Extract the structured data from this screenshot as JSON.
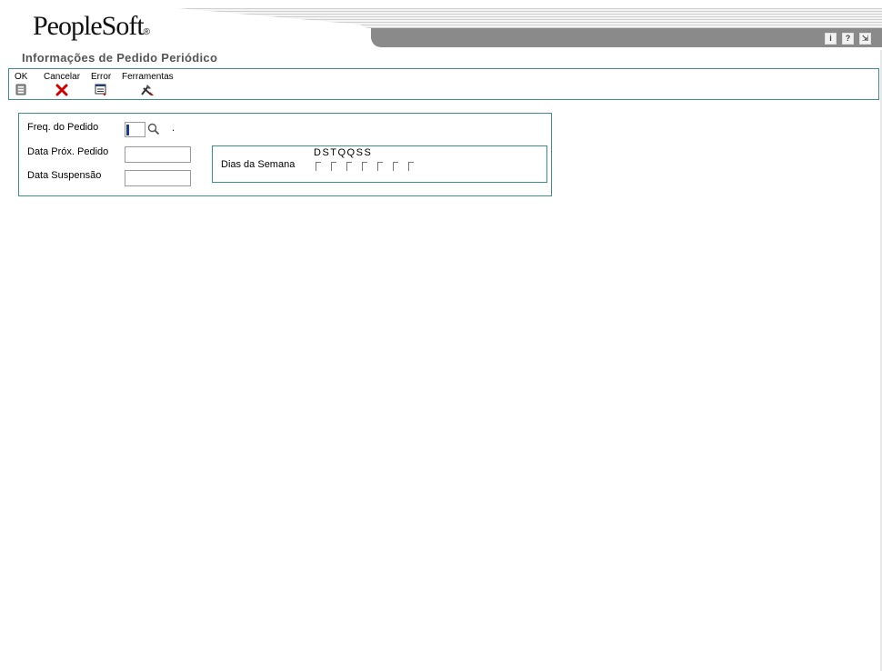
{
  "header": {
    "logo_text": "PeopleSoft",
    "logo_mark": "®",
    "icons": [
      "info-icon",
      "help-icon",
      "exit-icon"
    ]
  },
  "page": {
    "title": "Informações de Pedido Periódico"
  },
  "toolbar": {
    "ok_label": "OK",
    "cancel_label": "Cancelar",
    "error_label": "Error",
    "tools_label": "Ferramentas"
  },
  "form": {
    "freq_label": "Freq. do Pedido",
    "freq_value": "",
    "freq_trailing": ".",
    "next_order_label": "Data Próx. Pedido",
    "next_order_value": "",
    "suspend_label": "Data Suspensão",
    "suspend_value": "",
    "days": {
      "label": "Dias da Semana",
      "letters": "DSTQQSS",
      "checked": [
        false,
        false,
        false,
        false,
        false,
        false,
        false
      ]
    }
  },
  "colors": {
    "border_teal": "#3f8f88",
    "header_gray": "#8a8a8a",
    "cancel_red": "#d10000"
  }
}
